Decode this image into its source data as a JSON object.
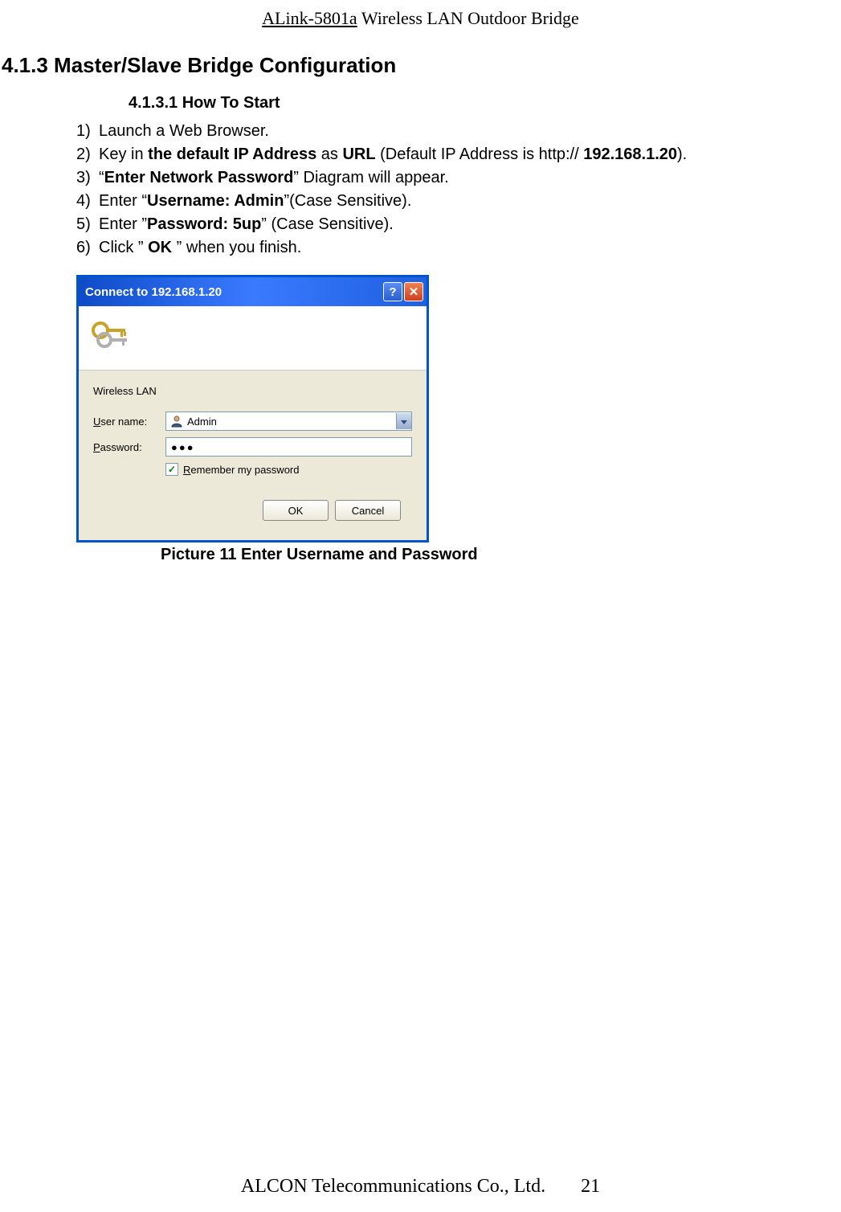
{
  "header": {
    "product": "ALink-5801a",
    "subtitle": "Wireless LAN Outdoor Bridge"
  },
  "section_heading": "4.1.3 Master/Slave Bridge Configuration",
  "subsection_heading": "4.1.3.1 How To Start",
  "steps": [
    {
      "num": "1)",
      "parts": [
        {
          "t": "Launch a Web Browser."
        }
      ]
    },
    {
      "num": "2)",
      "parts": [
        {
          "t": "Key in "
        },
        {
          "t": "the default IP Address",
          "b": true
        },
        {
          "t": " as "
        },
        {
          "t": "URL",
          "b": true
        },
        {
          "t": " (Default IP Address is http:// "
        },
        {
          "t": "192.168.1.20",
          "b": true
        },
        {
          "t": ")."
        }
      ]
    },
    {
      "num": "3)",
      "parts": [
        {
          "t": "“"
        },
        {
          "t": "Enter Network Password",
          "b": true
        },
        {
          "t": "” Diagram will appear."
        }
      ]
    },
    {
      "num": "4)",
      "parts": [
        {
          "t": "Enter “"
        },
        {
          "t": "Username: Admin",
          "b": true
        },
        {
          "t": "”(Case Sensitive)."
        }
      ]
    },
    {
      "num": "5)",
      "parts": [
        {
          "t": "Enter ”"
        },
        {
          "t": "Password: 5up",
          "b": true
        },
        {
          "t": "” (Case Sensitive)."
        }
      ]
    },
    {
      "num": "6)",
      "parts": [
        {
          "t": "Click ” "
        },
        {
          "t": "OK",
          "b": true
        },
        {
          "t": " ” when you finish."
        }
      ]
    }
  ],
  "dialog": {
    "title": "Connect to 192.168.1.20",
    "realm": "Wireless LAN",
    "username_label_pre": "U",
    "username_label_post": "ser name:",
    "username_value": "Admin",
    "password_label_pre": "P",
    "password_label_post": "assword:",
    "password_masked": "●●●",
    "remember_pre": "R",
    "remember_post": "emember my password",
    "ok_label": "OK",
    "cancel_label": "Cancel"
  },
  "caption": "Picture 11 Enter Username and Password",
  "footer": {
    "company": "ALCON Telecommunications Co., Ltd.",
    "page": "21"
  }
}
